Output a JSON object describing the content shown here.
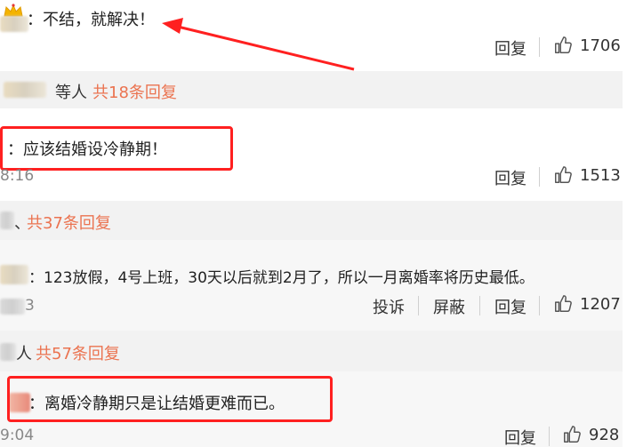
{
  "comments": [
    {
      "text": "：不结，就解决！",
      "reply_label": "回复",
      "likes": "1706"
    },
    {
      "reply_summary_users": "等人",
      "reply_summary_count": "共18条回复",
      "text": "：应该结婚设冷静期！",
      "time": "8:16",
      "reply_label": "回复",
      "likes": "1513"
    },
    {
      "reply_summary_users": "、",
      "reply_summary_count": "共37条回复",
      "text": "：123放假，4号上班，30天以后就到2月了，所以一月离婚率将历史最低。",
      "time": "3",
      "report_label": "投诉",
      "block_label": "屏蔽",
      "reply_label": "回复",
      "likes": "1207"
    },
    {
      "reply_summary_users": "人",
      "reply_summary_count": "共57条回复",
      "text": "：离婚冷静期只是让结婚更难而已。",
      "time": "9:04",
      "reply_label": "回复",
      "likes": "928"
    }
  ],
  "colors": {
    "annotation": "#ff2020",
    "reply_count": "#eb7350"
  },
  "icons": [
    "crown-icon",
    "thumbs-up-icon",
    "annotation-arrow"
  ]
}
